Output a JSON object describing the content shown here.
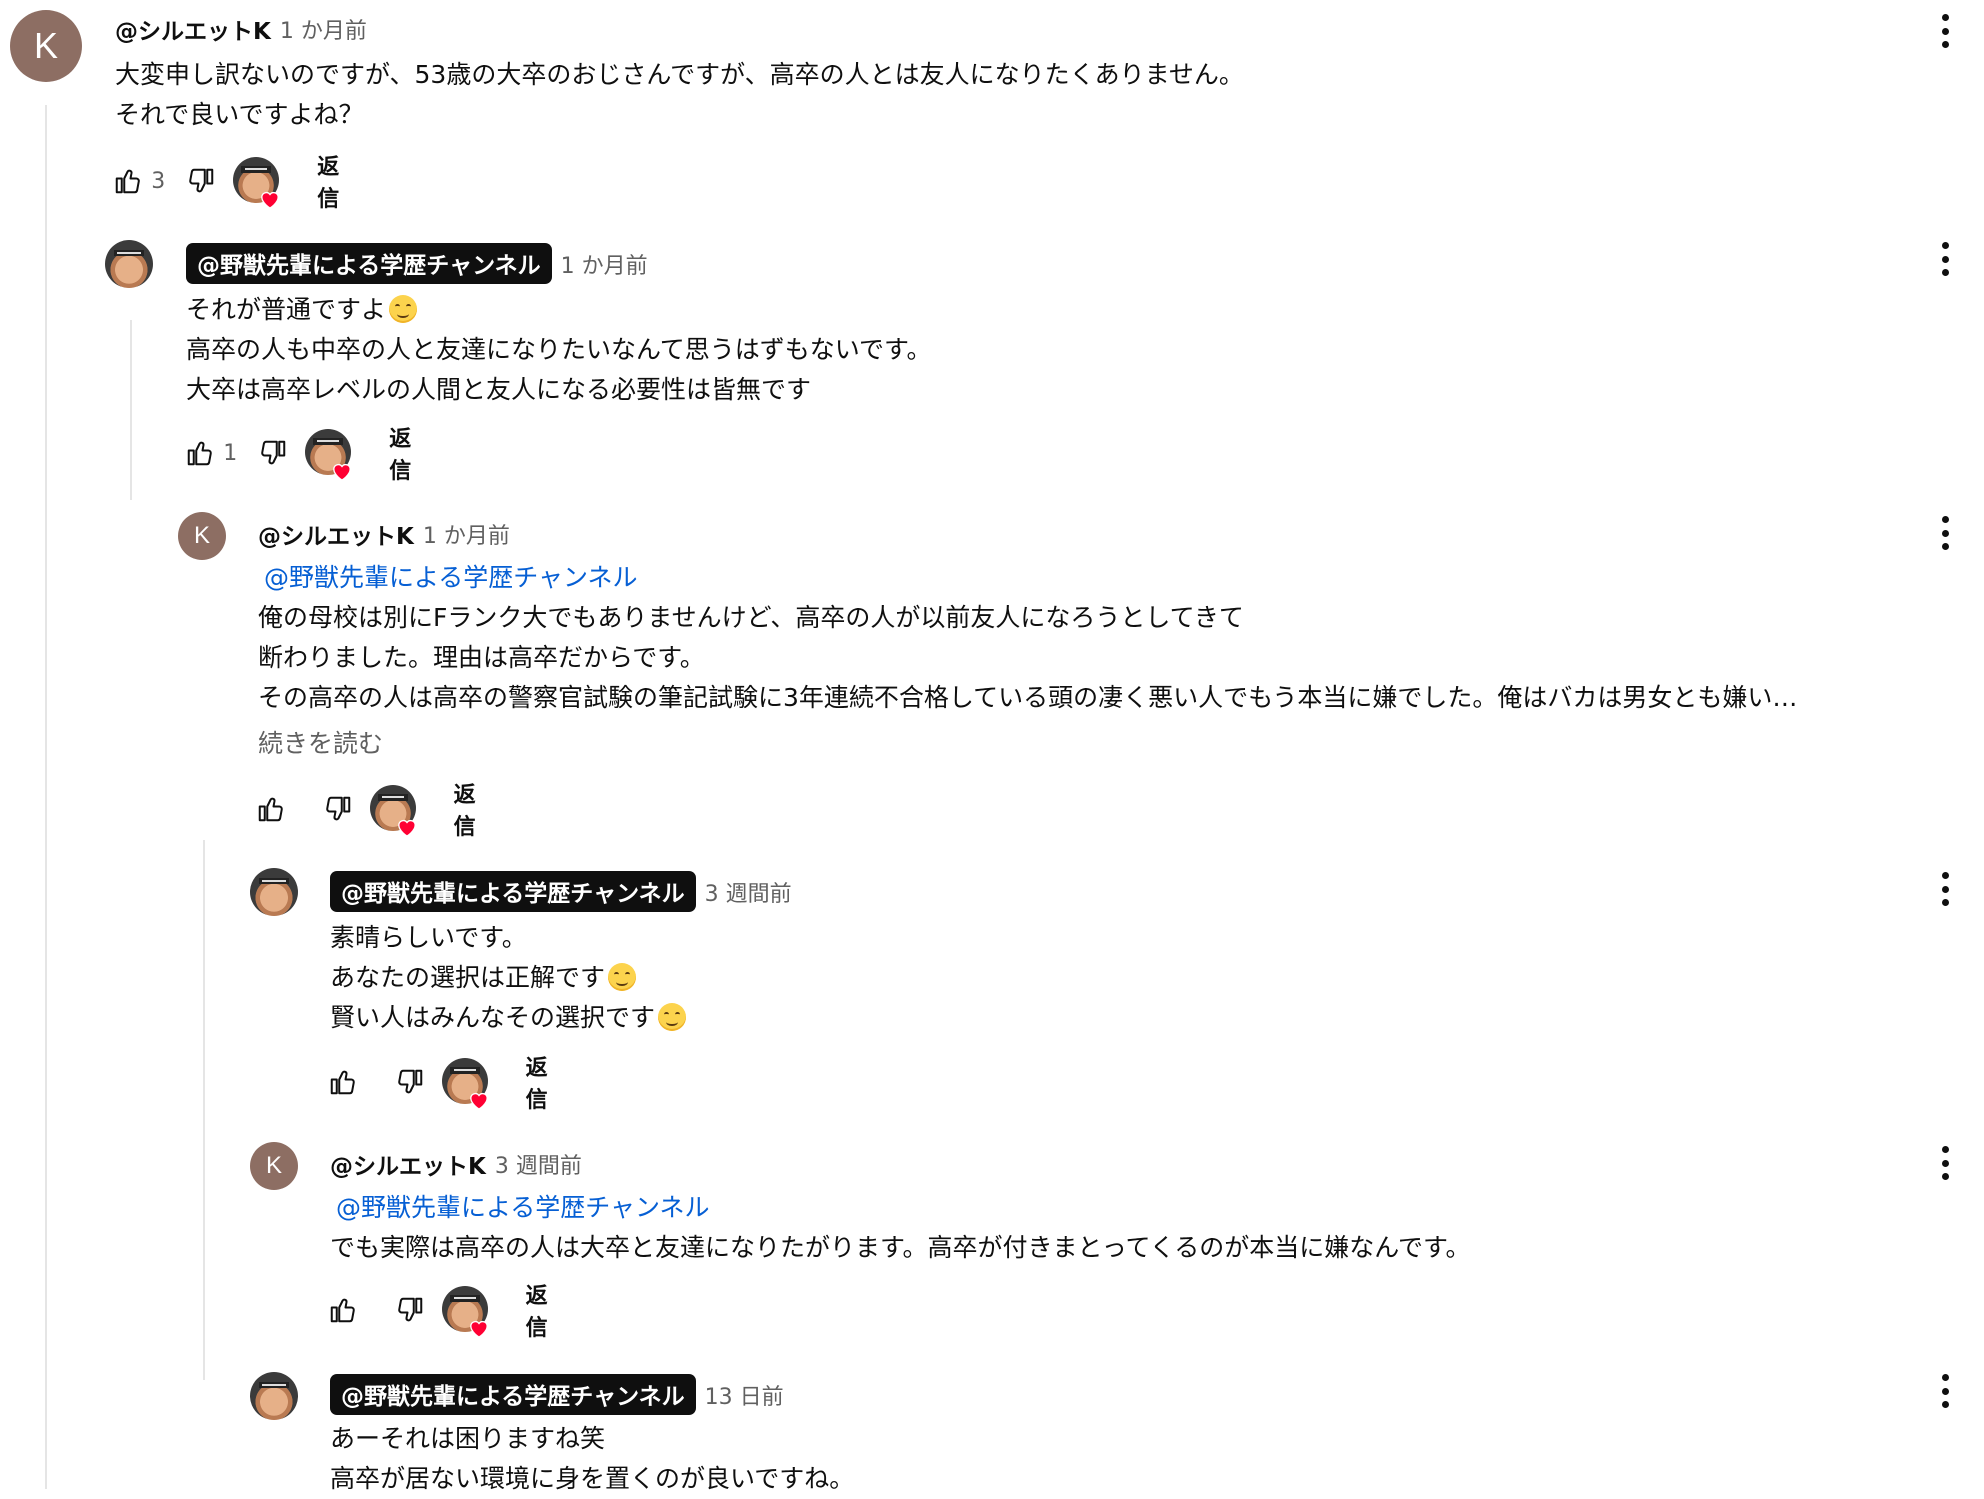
{
  "comments": [
    {
      "author": "@シルエットK",
      "owner": false,
      "avatar_letter": "K",
      "time": "1 か月前",
      "lines": [
        {
          "text": "大変申し訳ないのですが、53歳の大卒のおじさんですが、高卒の人とは友人になりたくありません。"
        },
        {
          "text": "それで良いですよね？"
        }
      ],
      "likes": "3",
      "reply_label": "返信"
    },
    {
      "author": "@野獣先輩による学歴チャンネル",
      "owner": true,
      "time": "1 か月前",
      "lines": [
        {
          "text": "それが普通ですよ",
          "emoji": "smiling-face-emoji"
        },
        {
          "text": "高卒の人も中卒の人と友達になりたいなんて思うはずもないです。"
        },
        {
          "text": "大卒は高卒レベルの人間と友人になる必要性は皆無です"
        }
      ],
      "likes": "1",
      "reply_label": "返信"
    },
    {
      "author": "@シルエットK",
      "owner": false,
      "avatar_letter": "K",
      "time": "1 か月前",
      "mention": "@野獣先輩による学歴チャンネル",
      "lines": [
        {
          "text": "俺の母校は別にFランク大でもありませんけど、高卒の人が以前友人になろうとしてきて"
        },
        {
          "text": "断わりました。理由は高卒だからです。"
        },
        {
          "text": "その高卒の人は高卒の警察官試験の筆記試験に3年連続不合格している頭の凄く悪い人でもう本当に嫌でした。俺はバカは男女とも嫌い…"
        }
      ],
      "read_more": "続きを読む",
      "likes": "",
      "reply_label": "返信"
    },
    {
      "author": "@野獣先輩による学歴チャンネル",
      "owner": true,
      "time": "3 週間前",
      "lines": [
        {
          "text": "素晴らしいです。"
        },
        {
          "text": "あなたの選択は正解です",
          "emoji": "smiling-face-emoji"
        },
        {
          "text": "賢い人はみんなその選択です",
          "emoji": "smiling-face-emoji"
        }
      ],
      "likes": "",
      "reply_label": "返信"
    },
    {
      "author": "@シルエットK",
      "owner": false,
      "avatar_letter": "K",
      "time": "3 週間前",
      "mention": "@野獣先輩による学歴チャンネル",
      "lines": [
        {
          "text": "でも実際は高卒の人は大卒と友達になりたがります。高卒が付きまとってくるのが本当に嫌なんです。"
        }
      ],
      "likes": "",
      "reply_label": "返信"
    },
    {
      "author": "@野獣先輩による学歴チャンネル",
      "owner": true,
      "time": "13 日前",
      "lines": [
        {
          "text": "あーそれは困りますね笑"
        },
        {
          "text": "高卒が居ない環境に身を置くのが良いですね。"
        }
      ]
    }
  ],
  "icons": {
    "like": "thumbs-up-icon",
    "dislike": "thumbs-down-icon",
    "creator_heart": "heart-icon",
    "more": "more-vert-icon"
  },
  "colors": {
    "mention": "#065fd4",
    "owner_badge_bg": "#0f0f0f",
    "heart": "#ff0033",
    "avatar_k": "#8d6e63",
    "secondary_text": "#606060"
  }
}
